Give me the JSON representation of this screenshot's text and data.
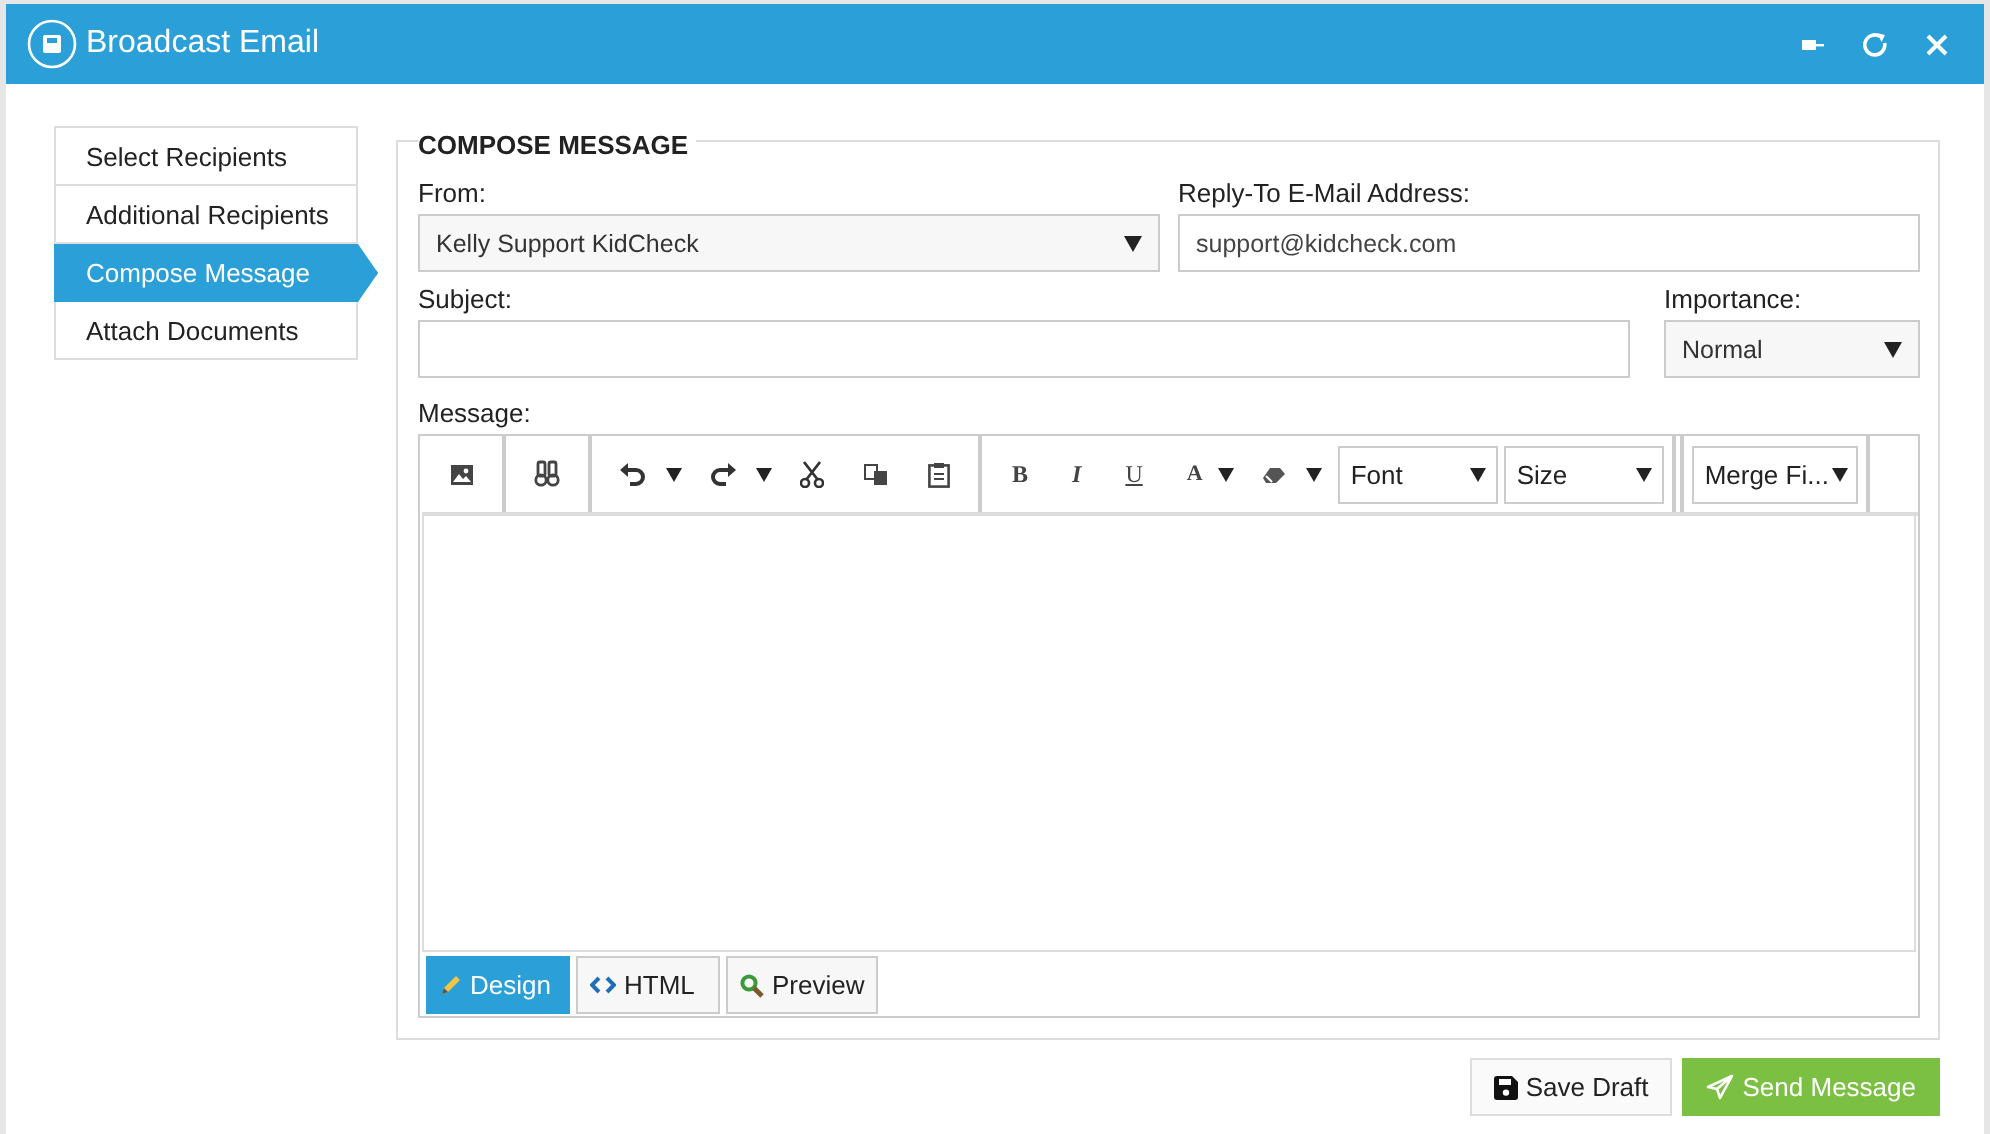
{
  "window": {
    "title": "Broadcast Email"
  },
  "sidebar": {
    "items": [
      {
        "label": "Select Recipients",
        "selected": false
      },
      {
        "label": "Additional Recipients",
        "selected": false
      },
      {
        "label": "Compose Message",
        "selected": true
      },
      {
        "label": "Attach Documents",
        "selected": false
      }
    ]
  },
  "compose": {
    "heading": "COMPOSE MESSAGE",
    "from": {
      "label": "From:",
      "value": "Kelly Support KidCheck"
    },
    "reply_to": {
      "label": "Reply-To E-Mail Address:",
      "value": "support@kidcheck.com"
    },
    "subject": {
      "label": "Subject:"
    },
    "importance": {
      "label": "Importance:",
      "value": "Normal"
    },
    "message": {
      "label": "Message:"
    },
    "toolbar": {
      "letters": [
        "B",
        "I",
        "U",
        "A"
      ],
      "selects": [
        "Font",
        "Size"
      ],
      "merge": "Merge Fi..."
    },
    "modes": [
      {
        "label": "Design",
        "selected": true
      },
      {
        "label": "HTML",
        "selected": false
      },
      {
        "label": "Preview",
        "selected": false
      }
    ]
  },
  "buttons": {
    "save": "Save Draft",
    "send": "Send Message"
  }
}
